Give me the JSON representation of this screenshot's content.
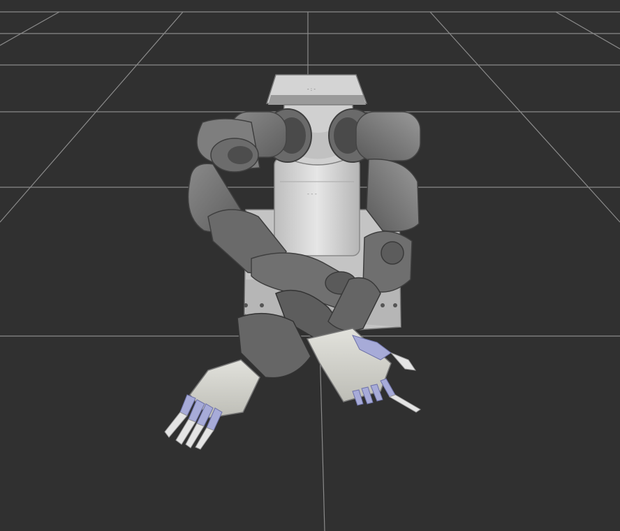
{
  "viewport": {
    "background": "#303030",
    "grid_color": "#9a9a9a",
    "grid_visible": true
  },
  "robot_model": {
    "icon": "dual-arm-robot-icon",
    "body_color": "#8f8f8f",
    "torso_color": "#cfcfcf",
    "dark_color": "#555555",
    "finger_color": "#a7abd8",
    "fingertip_color": "#e4e4e4"
  }
}
